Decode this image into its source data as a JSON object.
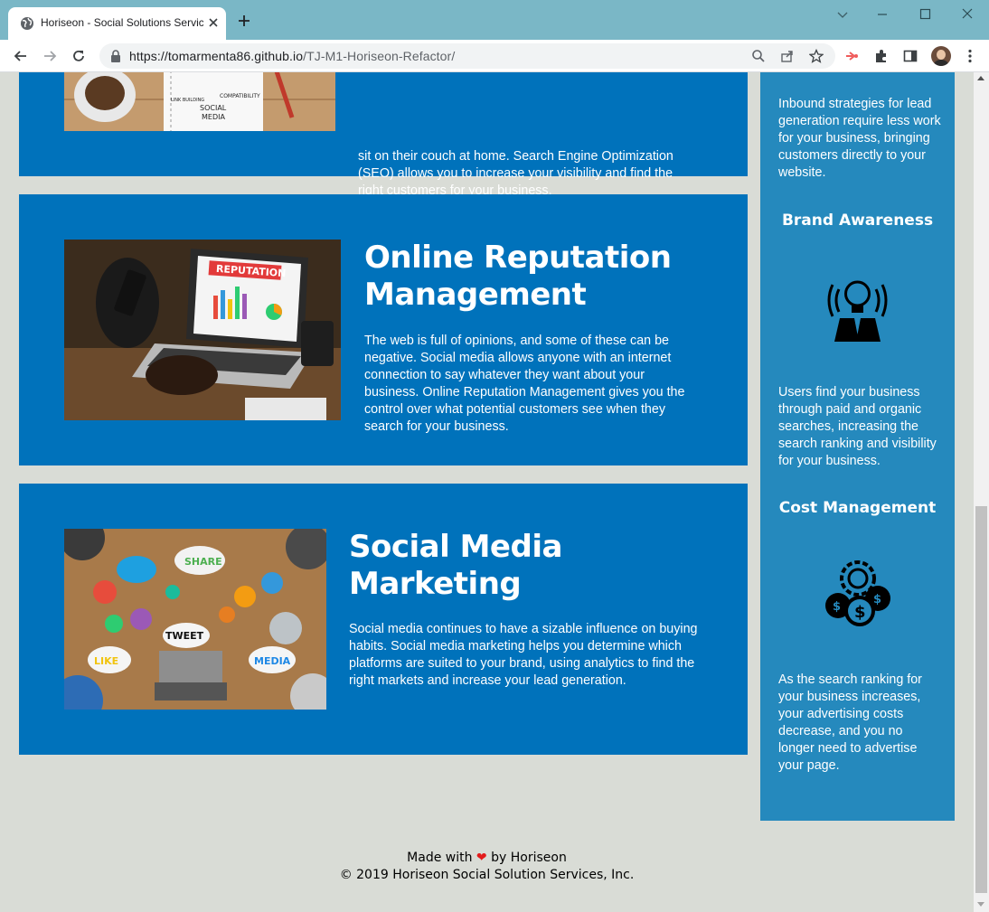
{
  "browser": {
    "tab_title": "Horiseon - Social Solutions Services",
    "url_host": "https://tomarmenta86.github.io",
    "url_path": "/TJ-M1-Horiseon-Refactor/"
  },
  "sections": {
    "seo_text": "business owners searching for the right business as they work, shop, or sit on their couch at home. Search Engine Optimization (SEO) allows you to increase your visibility and find the right customers for your business.",
    "seo_visible_1": "sit on their couch at home. Search Engine Optimization",
    "seo_visible_2": "(SEO) allows you to increase your visibility and find the",
    "seo_visible_3": "right customers for your business.",
    "orm_title_1": "Online Reputation",
    "orm_title_2": "Management",
    "orm_text": "The web is full of opinions, and some of these can be negative. Social media allows anyone with an internet connection to say whatever they want about your business. Online Reputation Management gives you the control over what potential customers see when they search for your business.",
    "smm_title_1": "Social Media",
    "smm_title_2": "Marketing",
    "smm_text": "Social media continues to have a sizable influence on buying habits. Social media marketing helps you determine which platforms are suited to your brand, using analytics to find the right markets and increase your lead generation.",
    "orm_image_banner": "REPUTATION",
    "smm_image_words": [
      "SHARE",
      "TWEET",
      "LIKE",
      "MEDIA"
    ],
    "seo_image_words": [
      "SOCIAL",
      "MEDIA",
      "COMPATIBILITY",
      "LINK BUILDING"
    ]
  },
  "aside": {
    "lead_text": "Inbound strategies for lead generation require less work for your business, bringing customers directly to your website.",
    "brand_title": "Brand Awareness",
    "brand_icon": "lightbulb-person-icon",
    "brand_text": "Users find your business through paid and organic searches, increasing the search ranking and visibility for your business.",
    "cost_title": "Cost Management",
    "cost_icon": "gear-coins-icon",
    "cost_text": "As the search ranking for your business increases, your advertising costs decrease, and you no longer need to advertise your page."
  },
  "footer": {
    "made_with": "Made with",
    "heart": "❤",
    "by": "by Horiseon",
    "copyright": "© 2019 Horiseon Social Solution Services, Inc."
  },
  "colors": {
    "section_bg": "#0072bb",
    "aside_bg": "#2589bd",
    "page_bg": "#d9dcd6",
    "tabbar_bg": "#7ab7c6"
  }
}
